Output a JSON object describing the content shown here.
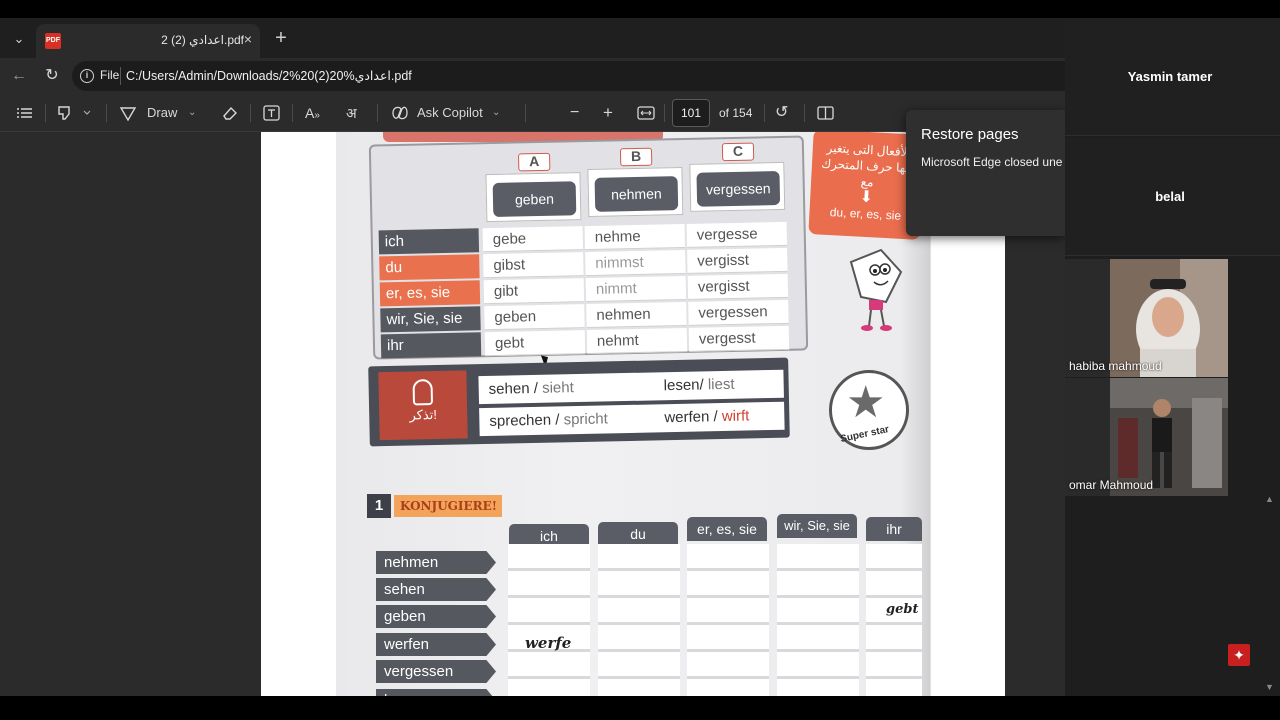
{
  "tab": {
    "title": "2 اعدادي (2).pdf",
    "close": "×",
    "new_tab": "+",
    "menu": "⌄"
  },
  "address": {
    "scheme": "File",
    "url": "C:/Users/Admin/Downloads/2%20(2)20%اعدادي.pdf"
  },
  "toolbar": {
    "draw_label": "Draw",
    "copilot_label": "Ask Copilot",
    "page_current": "101",
    "page_total": "of 154",
    "zoom_out": "−",
    "zoom_in": "+"
  },
  "restore_popup": {
    "title": "Restore pages",
    "body": "Microsoft Edge closed une"
  },
  "participants": [
    {
      "name": "Yasmin tamer",
      "video": false
    },
    {
      "name": "belal",
      "video": false
    },
    {
      "name": "habiba mahmoud",
      "video": true
    },
    {
      "name": "omar Mahmoud",
      "video": true
    }
  ],
  "pdf_content": {
    "column_letters": [
      "A",
      "B",
      "C"
    ],
    "column_verbs": [
      "geben",
      "nehmen",
      "vergessen"
    ],
    "pronouns": [
      "ich",
      "du",
      "er, es, sie",
      "wir, Sie, sie",
      "ihr"
    ],
    "rows": [
      [
        "gebe",
        "nehme",
        "vergesse"
      ],
      [
        "gibst",
        "nimmst",
        "vergisst"
      ],
      [
        "gibt",
        "nimmt",
        "vergisst"
      ],
      [
        "geben",
        "nehmen",
        "vergessen"
      ],
      [
        "gebt",
        "nehmt",
        "vergesst"
      ]
    ],
    "arabic_note": "الأفعال التى يتغير فيها حرف المتحرك مع",
    "arabic_pronouns": "du, er, es, sie",
    "tip_label": "تذكر!",
    "tip_line1_left": "sehen",
    "tip_line1_left_alt": "sieht",
    "tip_line1_right": "lesen/",
    "tip_line1_right_alt": "liest",
    "tip_line2_left": "sprechen",
    "tip_line2_left_alt": "spricht",
    "tip_line2_right": "werfen /",
    "tip_line2_right_alt": "wirft",
    "slash": "/",
    "badge_text": "Super star",
    "exercise_number": "1",
    "exercise_title": "KONJUGIERE!",
    "conj_heads": [
      "ich",
      "du",
      "er, es, sie",
      "wir, Sie, sie",
      "ihr"
    ],
    "conj_verbs": [
      "nehmen",
      "sehen",
      "geben",
      "werfen",
      "vergessen",
      "lesen"
    ],
    "handwritten_ich": "werfe",
    "handwritten_ihr": "gebt"
  }
}
